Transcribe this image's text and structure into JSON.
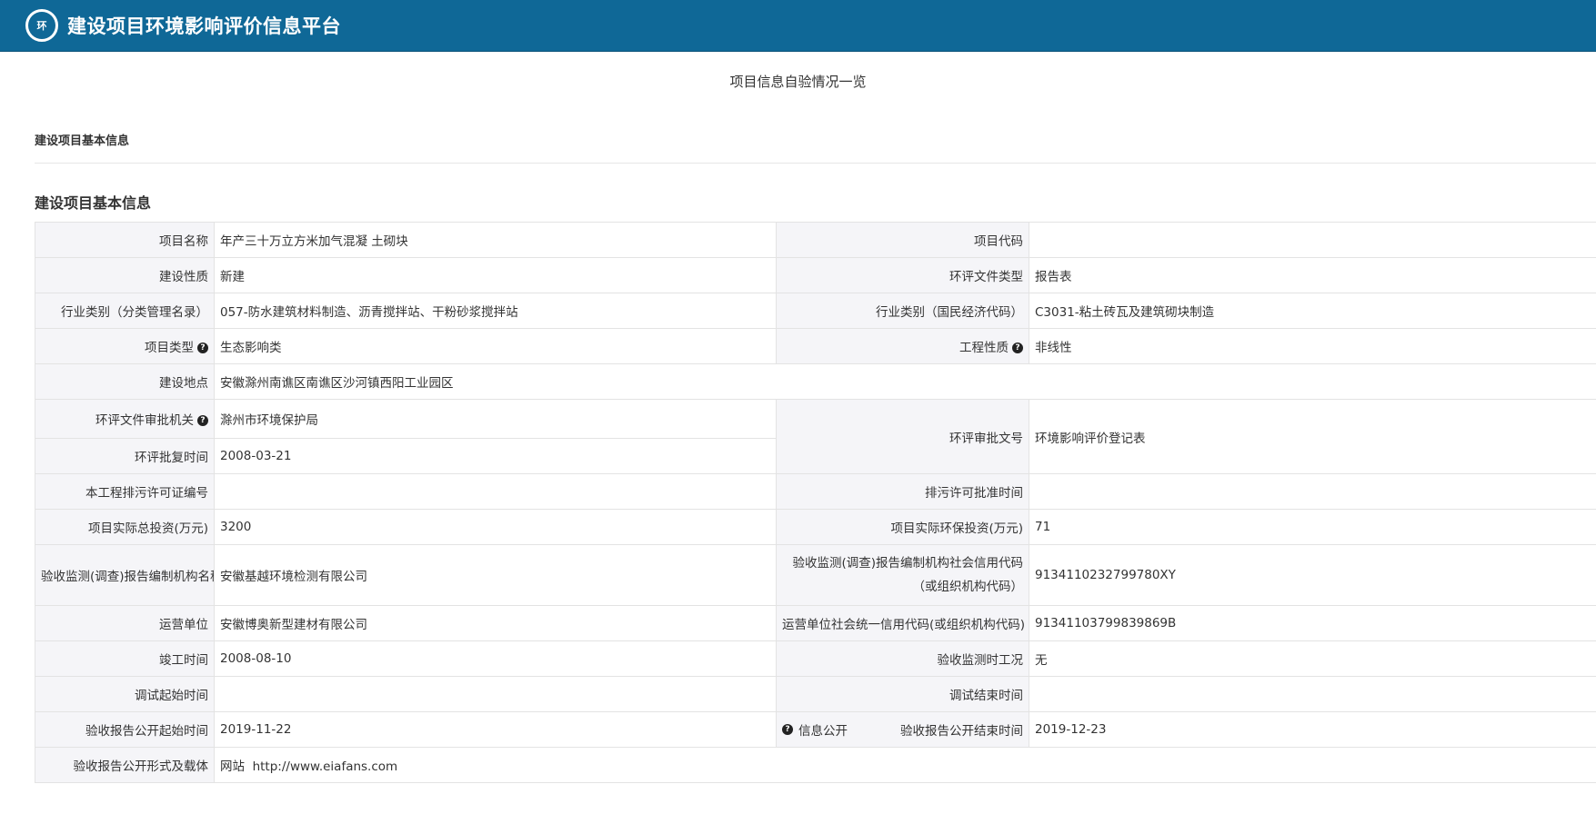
{
  "header": {
    "app_title": "建设项目环境影响评价信息平台",
    "logo_text": "环"
  },
  "page_title": "项目信息自验情况一览",
  "section_header": "建设项目基本信息",
  "section_title": "建设项目基本信息",
  "rows": {
    "r1": {
      "l1": "项目名称",
      "v1": "年产三十万立方米加气混凝 土砌块",
      "l2": "项目代码",
      "v2": ""
    },
    "r2": {
      "l1": "建设性质",
      "v1": "新建",
      "l2": "环评文件类型",
      "v2": "报告表"
    },
    "r3": {
      "l1": "行业类别（分类管理名录）",
      "v1": "057-防水建筑材料制造、沥青搅拌站、干粉砂浆搅拌站",
      "l2": "行业类别（国民经济代码）",
      "v2": "C3031-粘土砖瓦及建筑砌块制造"
    },
    "r4": {
      "l1": "项目类型",
      "v1": "生态影响类",
      "l2": "工程性质",
      "v2": "非线性"
    },
    "r5": {
      "l1": "建设地点",
      "v1": "安徽滁州南谯区南谯区沙河镇西阳工业园区"
    },
    "r6": {
      "l1": "环评文件审批机关",
      "v1": "滁州市环境保护局",
      "l2": "环评审批文号",
      "v2": "环境影响评价登记表"
    },
    "r7": {
      "l1": "环评批复时间",
      "v1": "2008-03-21"
    },
    "r8": {
      "l1": "本工程排污许可证编号",
      "v1": "",
      "l2": "排污许可批准时间",
      "v2": ""
    },
    "r9": {
      "l1": "项目实际总投资(万元)",
      "v1": "3200",
      "l2": "项目实际环保投资(万元)",
      "v2": "71"
    },
    "r10": {
      "l1": "验收监测(调查)报告编制机构名称",
      "v1": "安徽基越环境检测有限公司",
      "l2": "验收监测(调查)报告编制机构社会信用代码（或组织机构代码）",
      "v2": "9134110232799780XY"
    },
    "r11": {
      "l1": "运营单位",
      "v1": "安徽博奥新型建材有限公司",
      "l2": "运营单位社会统一信用代码(或组织机构代码)",
      "v2": "91341103799839869B"
    },
    "r12": {
      "l1": "竣工时间",
      "v1": "2008-08-10",
      "l2": "验收监测时工况",
      "v2": "无"
    },
    "r13": {
      "l1": "调试起始时间",
      "v1": "",
      "l2": "调试结束时间",
      "v2": ""
    },
    "r14": {
      "l1": "验收报告公开起始时间",
      "v1": "2019-11-22",
      "pub": "信息公开",
      "l2": "验收报告公开结束时间",
      "v2": "2019-12-23"
    },
    "r15": {
      "l1": "验收报告公开形式及载体",
      "v1": "网站  http://www.eiafans.com"
    }
  },
  "icons": {
    "help": "question-circle-icon",
    "logo": "environment-emblem-icon"
  },
  "colors": {
    "header_bg": "#0f6897",
    "label_bg": "#f5f5f8",
    "border": "#e3e3e3"
  }
}
